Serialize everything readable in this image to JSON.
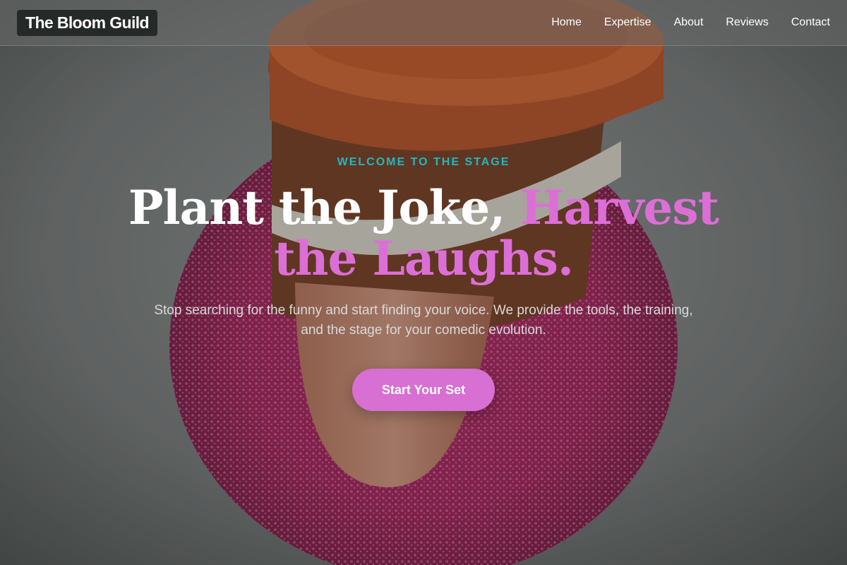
{
  "nav": {
    "brand": "The Bloom Guild",
    "links": [
      "Home",
      "Expertise",
      "About",
      "Reviews",
      "Contact"
    ]
  },
  "hero": {
    "eyebrow": "WELCOME TO THE STAGE",
    "headline_plain": "Plant the Joke, ",
    "headline_accent": "Harvest the Laughs.",
    "subtext": "Stop searching for the funny and start finding your voice. We provide the tools, the training, and the stage for your comedic evolution.",
    "cta_label": "Start Your Set"
  },
  "colors": {
    "accent_pink": "#dc6fd6",
    "accent_teal": "#22b8bd",
    "brand_bg": "#252a28"
  }
}
